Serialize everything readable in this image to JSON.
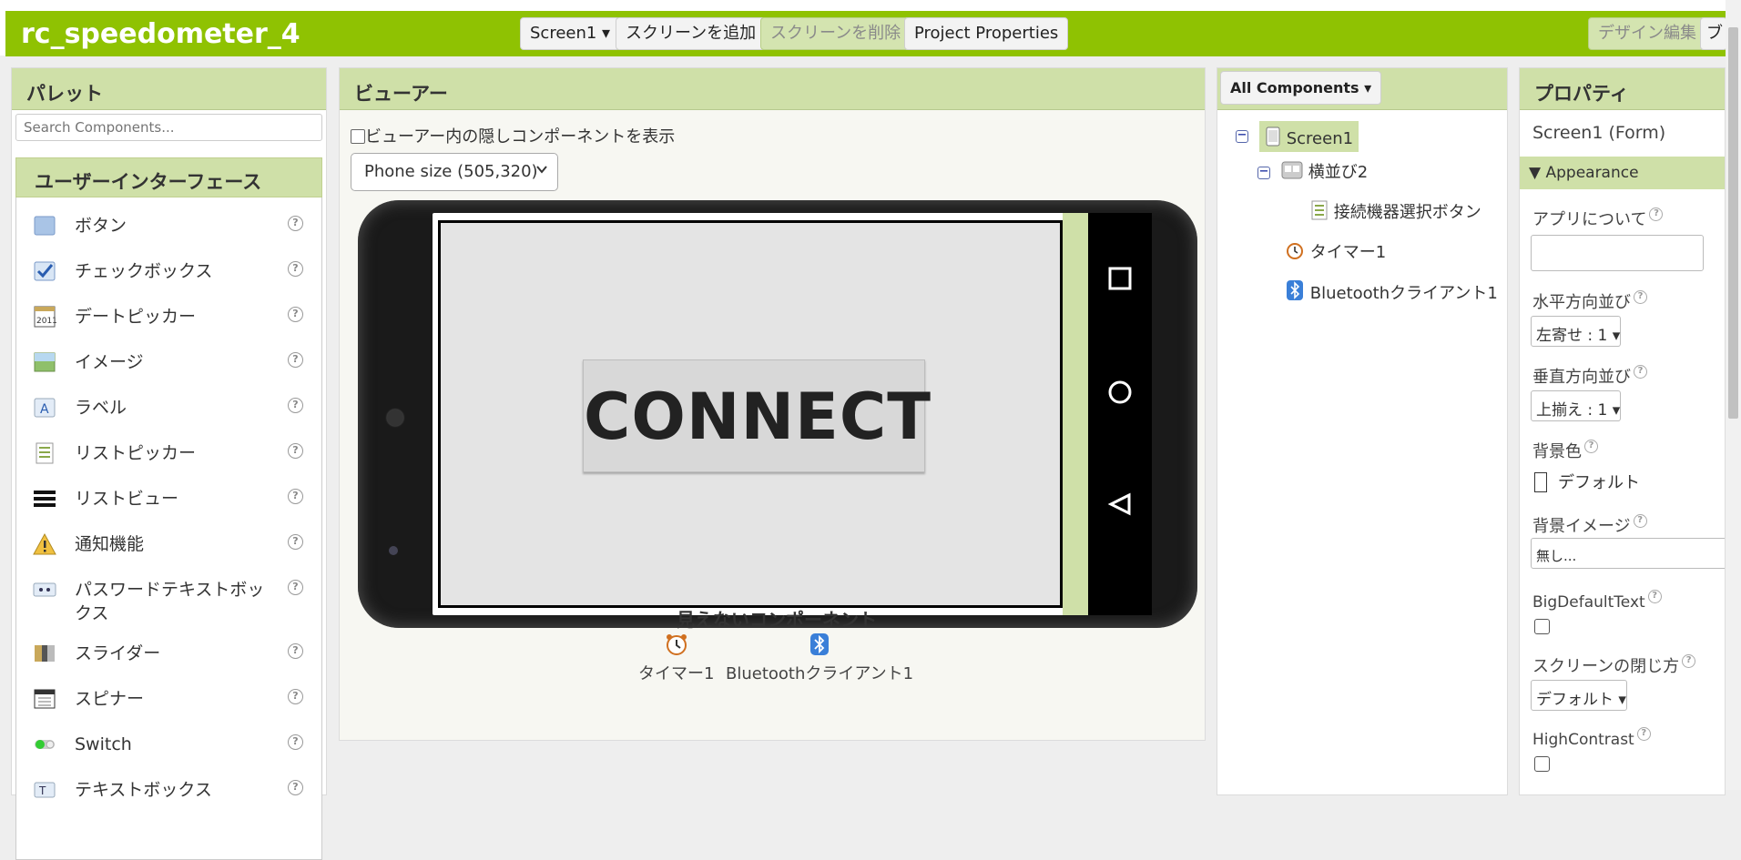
{
  "app": {
    "title": "rc_speedometer_4"
  },
  "toolbar": {
    "screen_select": "Screen1 ▾",
    "add_screen": "スクリーンを追加",
    "remove_screen": "スクリーンを削除",
    "project_properties": "Project Properties",
    "design_edit": "デザイン編集",
    "blocks_cut": "ブ"
  },
  "palette": {
    "title": "パレット",
    "search_placeholder": "Search Components...",
    "category": "ユーザーインターフェース",
    "items": [
      {
        "label": "ボタン",
        "icon": "button-icon"
      },
      {
        "label": "チェックボックス",
        "icon": "checkbox-icon"
      },
      {
        "label": "デートピッカー",
        "icon": "datepicker-icon"
      },
      {
        "label": "イメージ",
        "icon": "image-icon"
      },
      {
        "label": "ラベル",
        "icon": "label-icon"
      },
      {
        "label": "リストピッカー",
        "icon": "listpicker-icon"
      },
      {
        "label": "リストビュー",
        "icon": "listview-icon"
      },
      {
        "label": "通知機能",
        "icon": "notifier-icon"
      },
      {
        "label": "パスワードテキストボックス",
        "icon": "password-icon"
      },
      {
        "label": "スライダー",
        "icon": "slider-icon"
      },
      {
        "label": "スピナー",
        "icon": "spinner-icon"
      },
      {
        "label": "Switch",
        "icon": "switch-icon"
      },
      {
        "label": "テキストボックス",
        "icon": "textbox-icon"
      }
    ]
  },
  "viewer": {
    "title": "ビューアー",
    "show_hidden_label": "ビューアー内の隠しコンポーネントを表示",
    "phone_size": "Phone size (505,320)",
    "connect_button": "CONNECT",
    "invisible_title": "見えないコンポーネント",
    "invisible": [
      {
        "label": "タイマー1",
        "icon": "clock-icon"
      },
      {
        "label": "Bluetoothクライアント1",
        "icon": "bluetooth-icon"
      }
    ]
  },
  "components": {
    "dropdown": "All Components ▾",
    "tree": {
      "screen": "Screen1",
      "horizontal": "横並び2",
      "listpicker": "接続機器選択ボタン",
      "timer": "タイマー1",
      "bluetooth": "Bluetoothクライアント1"
    }
  },
  "properties": {
    "title": "プロパティ",
    "subtitle": "Screen1 (Form)",
    "section": "Appearance",
    "about_label": "アプリについて",
    "align_h_label": "水平方向並び",
    "align_h_value": "左寄せ : 1 ▾",
    "align_v_label": "垂直方向並び",
    "align_v_value": "上揃え : 1 ▾",
    "bg_color_label": "背景色",
    "bg_color_value": "デフォルト",
    "bg_image_label": "背景イメージ",
    "bg_image_value": "無し...",
    "big_default_text_label": "BigDefaultText",
    "close_anim_label": "スクリーンの閉じ方",
    "close_anim_value": "デフォルト ▾",
    "high_contrast_label": "HighContrast"
  },
  "colors": {
    "brand_green": "#8fc202",
    "header_green": "#cfe0a8"
  }
}
